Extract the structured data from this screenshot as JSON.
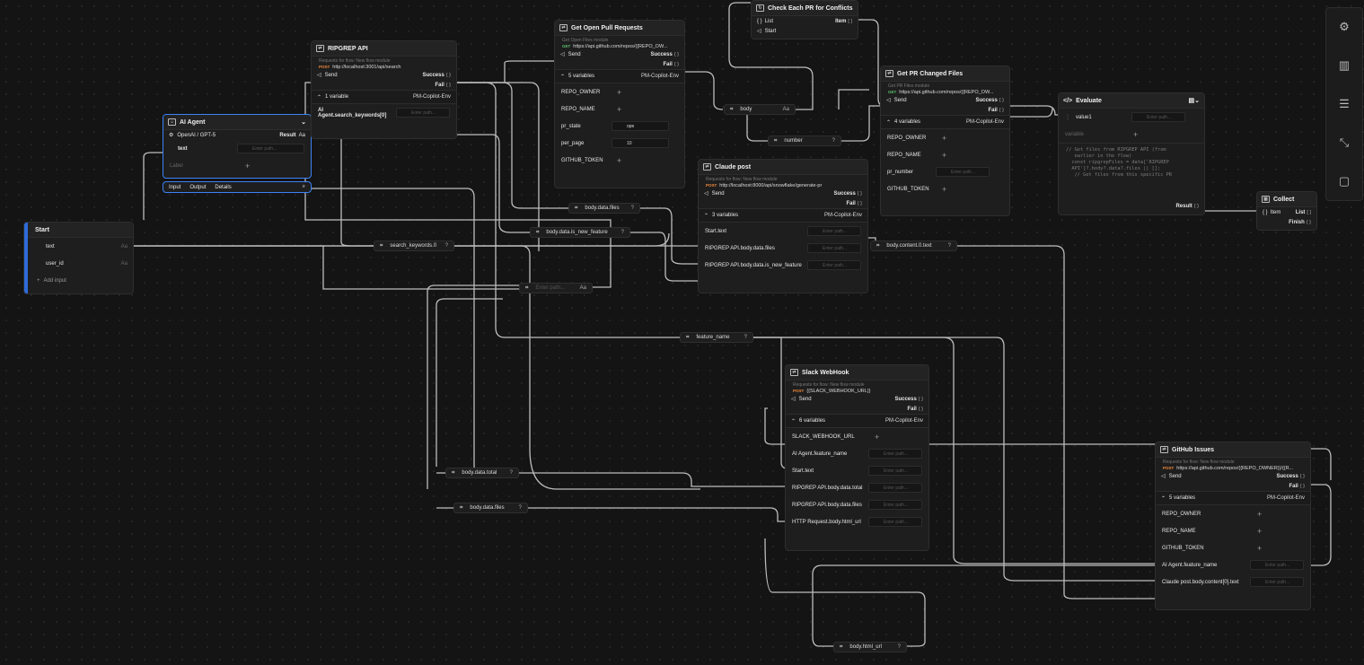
{
  "start": {
    "title": "Start",
    "inputs": [
      {
        "name": "text",
        "type": "Aa"
      },
      {
        "name": "user_id",
        "type": "Aa"
      }
    ],
    "add_input": "Add input"
  },
  "ai_agent": {
    "title": "AI Agent",
    "model": "OpenAI / GPT-5",
    "result": "Result",
    "result_type": "Aa",
    "param": "text",
    "placeholder": "Enter path...",
    "label_placeholder": "Label",
    "tabs": [
      "Input",
      "Output",
      "Details"
    ]
  },
  "ripgrep": {
    "title": "RIPGREP API",
    "subtitle": "Requests for flow: New flow module",
    "method": "POST",
    "url": "http://localhost:3001/api/search",
    "send": "Send",
    "success": "Success",
    "fail": "Fail",
    "vars_label": "1 variable",
    "env": "PM-Copilot-Env",
    "var1": "AI Agent.search_keywords[0]",
    "placeholder": "Enter path..."
  },
  "open_prs": {
    "title": "Get Open Pull Requests",
    "subtitle": "Get Open Files module",
    "method": "GET",
    "url": "https://api.github.com/repos/{{REPO_OW...",
    "send": "Send",
    "success": "Success",
    "fail": "Fail",
    "vars_label": "5 variables",
    "env": "PM-Copilot-Env",
    "vars": [
      "REPO_OWNER",
      "REPO_NAME",
      "pr_state",
      "per_page",
      "GITHUB_TOKEN"
    ],
    "pr_state_value": "ope",
    "per_page_value": "10"
  },
  "check_each": {
    "title": "Check Each PR for Conflicts",
    "list": "List",
    "item": "Item",
    "start": "Start"
  },
  "pr_changed": {
    "title": "Get PR Changed Files",
    "subtitle": "Get PR Files module",
    "method": "GET",
    "url": "https://api.github.com/repos/{{REPO_OW...",
    "send": "Send",
    "success": "Success",
    "fail": "Fail",
    "vars_label": "4 variables",
    "env": "PM-Copilot-Env",
    "vars": [
      "REPO_OWNER",
      "REPO_NAME",
      "pr_number",
      "GITHUB_TOKEN"
    ],
    "placeholder": "Enter path..."
  },
  "evaluate": {
    "title": "Evaluate",
    "var": "value1",
    "placeholder": "Enter path...",
    "var_placeholder": "variable",
    "code": [
      "// Get files from RIPGREP API (from",
      "   earlier in the flow)",
      "  const ripgrepFiles = data['RIPGREP",
      "  API']?.body?.data?.files || [];",
      "",
      "   // Get files from this specific PR"
    ],
    "result": "Result"
  },
  "collect": {
    "title": "Collect",
    "item": "Item",
    "list": "List",
    "finish": "Finish"
  },
  "claude": {
    "title": "Claude post",
    "subtitle": "Requests for flow: New flow module",
    "method": "POST",
    "url": "http://localhost:8000/api/snowflake/generate-pr",
    "send": "Send",
    "success": "Success",
    "fail": "Fail",
    "vars_label": "3 variables",
    "env": "PM-Copilot-Env",
    "vars": [
      "Start.text",
      "RIPGREP API.body.data.files",
      "RIPGREP API.body.data.is_new_feature"
    ],
    "placeholder": "Enter path..."
  },
  "slack": {
    "title": "Slack WebHook",
    "subtitle": "Requests for flow: New flow module",
    "method": "POST",
    "url": "{{SLACK_WEBHOOK_URL}}",
    "send": "Send",
    "success": "Success",
    "fail": "Fail",
    "vars_label": "6 variables",
    "env": "PM-Copilot-Env",
    "vars": [
      "SLACK_WEBHOOK_URL",
      "AI Agent.feature_name",
      "Start.text",
      "RIPGREP API.body.data.total",
      "RIPGREP API.body.data.files",
      "HTTP Request.body.html_url"
    ],
    "placeholder": "Enter path..."
  },
  "github_issues": {
    "title": "GitHub Issues",
    "subtitle": "Requests for flow: New flow module",
    "method": "POST",
    "url": "https://api.github.com/repos/{{REPO_OWNER}}/{{R...",
    "send": "Send",
    "success": "Success",
    "fail": "Fail",
    "vars_label": "5 variables",
    "env": "PM-Copilot-Env",
    "vars": [
      "REPO_OWNER",
      "REPO_NAME",
      "GITHUB_TOKEN",
      "AI Agent.feature_name",
      "Claude post.body.content[0].text"
    ],
    "placeholder": "Enter path..."
  },
  "chips": {
    "body": "body",
    "body_type": "Aa",
    "number": "number",
    "body_data_files": "body.data.files",
    "is_new_feature": "body.data.is_new_feature",
    "search_kw": "search_keywords.0",
    "enter_path": "Enter path...",
    "enter_type": "Aa",
    "feature_name": "feature_name",
    "body_content": "body.content.0.text",
    "body_data_total": "body.data.total",
    "body_data_files2": "body.data.files",
    "html_url": "body.html_url",
    "q": "?"
  },
  "toolbar": [
    "gear-icon",
    "book-icon",
    "flow-icon",
    "expand-icon",
    "chat-icon"
  ]
}
